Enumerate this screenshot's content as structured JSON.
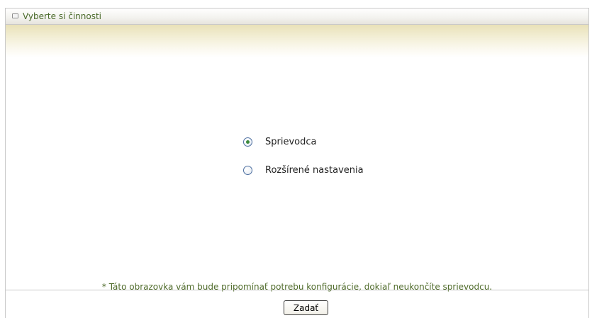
{
  "panel": {
    "title": "Vyberte si činnosti",
    "title_icon": "square-bullet-icon"
  },
  "options": [
    {
      "label": "Sprievodca",
      "selected": true
    },
    {
      "label": "Rozšírené nastavenia",
      "selected": false
    }
  ],
  "footer": {
    "note": "* Táto obrazovka vám bude pripomínať potrebu konfigurácie, dokiaľ neukončíte sprievodcu.",
    "submit_label": "Zadať"
  },
  "colors": {
    "title_text": "#4a6a2a",
    "note_text": "#4f6b2a",
    "band": "#e9e1b8",
    "radio_border": "#4d6fa0",
    "radio_dot": "#3c8a3c"
  }
}
